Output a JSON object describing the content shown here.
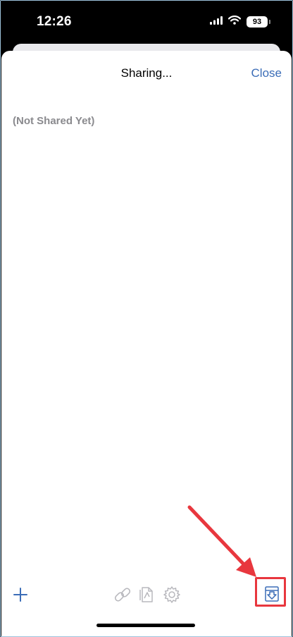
{
  "status_bar": {
    "time": "12:26",
    "battery": "93",
    "icons": [
      "signal-icon",
      "wifi-icon",
      "battery-icon"
    ]
  },
  "sheet": {
    "title": "Sharing...",
    "close_label": "Close",
    "empty_text": "(Not Shared Yet)"
  },
  "toolbar": {
    "icons": [
      "add-icon",
      "link-icon",
      "page-icon",
      "gear-icon",
      "save-download-icon"
    ]
  },
  "colors": {
    "accent": "#3b6db7",
    "annotation": "#e8373e",
    "muted_text": "#8a8a8e",
    "disabled_icon": "#b8b8bd"
  }
}
